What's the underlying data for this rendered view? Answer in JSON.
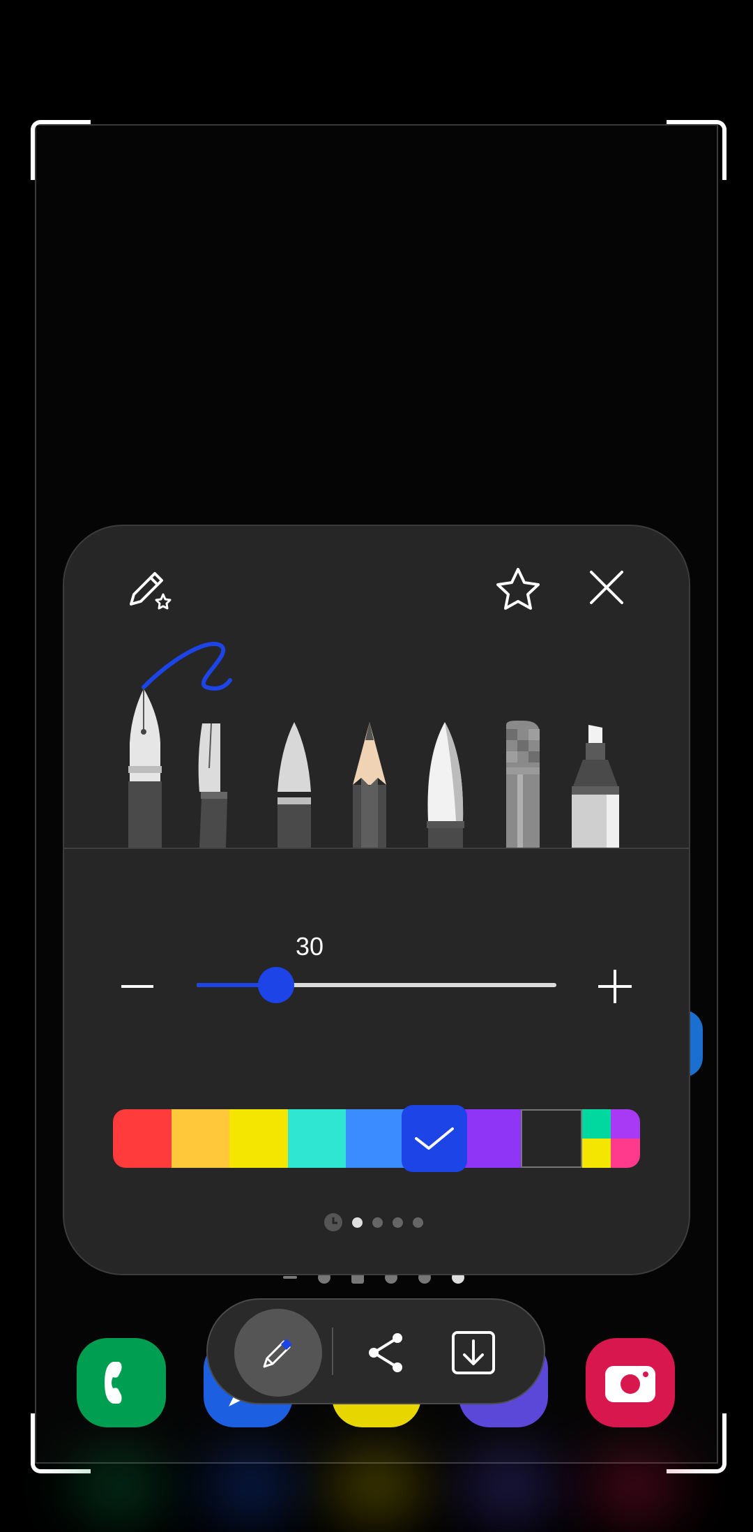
{
  "brush_settings": {
    "favorites_pen_icon": "pen-with-star-icon",
    "star_icon": "star-icon",
    "close_icon": "close-icon",
    "pens": [
      "fountain-pen",
      "calligraphy-pen",
      "brush-pen",
      "pencil",
      "marker-pen",
      "pixel-pen",
      "highlighter"
    ],
    "selected_pen": "fountain-pen",
    "size": {
      "value": "30",
      "fraction": 0.22,
      "decrease_icon": "minus-icon",
      "increase_icon": "plus-icon"
    },
    "colors": [
      "#ff3b3b",
      "#ffc83a",
      "#f5e600",
      "#2ee6d2",
      "#3a8cff",
      "#1d44e6",
      "#8f35f5",
      "#262626"
    ],
    "multi_color": [
      "#00d8a0",
      "#a83af5",
      "#f5e600",
      "#ff3a8c"
    ],
    "selected_color": "#1d44e6",
    "pager": {
      "pages": 4,
      "current": 1
    }
  },
  "toolbar": {
    "pen_icon": "pen-icon",
    "share_icon": "share-icon",
    "save_icon": "download-icon"
  },
  "home_apps": [
    "phone-icon",
    "messages-icon",
    "talk-icon",
    "chat-icon",
    "camera-icon"
  ]
}
